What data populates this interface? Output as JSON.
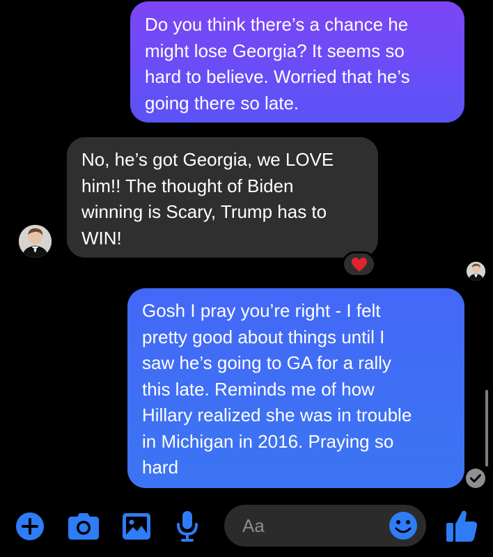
{
  "messages": [
    {
      "direction": "outgoing",
      "text": "Do you think there’s a chance he\nmight lose Georgia? It seems so\nhard to believe. Worried that he’s\ngoing there so late."
    },
    {
      "direction": "incoming",
      "text": "No, he’s got Georgia, we LOVE\nhim!! The thought of Biden\nwinning is Scary, Trump has to\nWIN!",
      "reaction": "heart"
    },
    {
      "direction": "outgoing",
      "text": "Gosh I pray you’re right - I felt\npretty good about things until I\nsaw he’s going to GA for a rally\nthis late. Reminds me of how\nHillary realized she was in trouble\nin Michigan in 2016. Praying so\nhard"
    }
  ],
  "composer": {
    "placeholder": "Aa"
  },
  "toolbar": {
    "icons": [
      "plus-icon",
      "camera-icon",
      "photo-icon",
      "microphone-icon",
      "emoji-icon",
      "thumbs-up-icon"
    ]
  },
  "colors": {
    "background": "#000000",
    "outgoing_bubble_top": "#7d45f6",
    "outgoing_bubble_bottom": "#3b75f3",
    "incoming_bubble": "#2f2f2f",
    "accent": "#2e7cf6",
    "heart": "#e0242b"
  }
}
